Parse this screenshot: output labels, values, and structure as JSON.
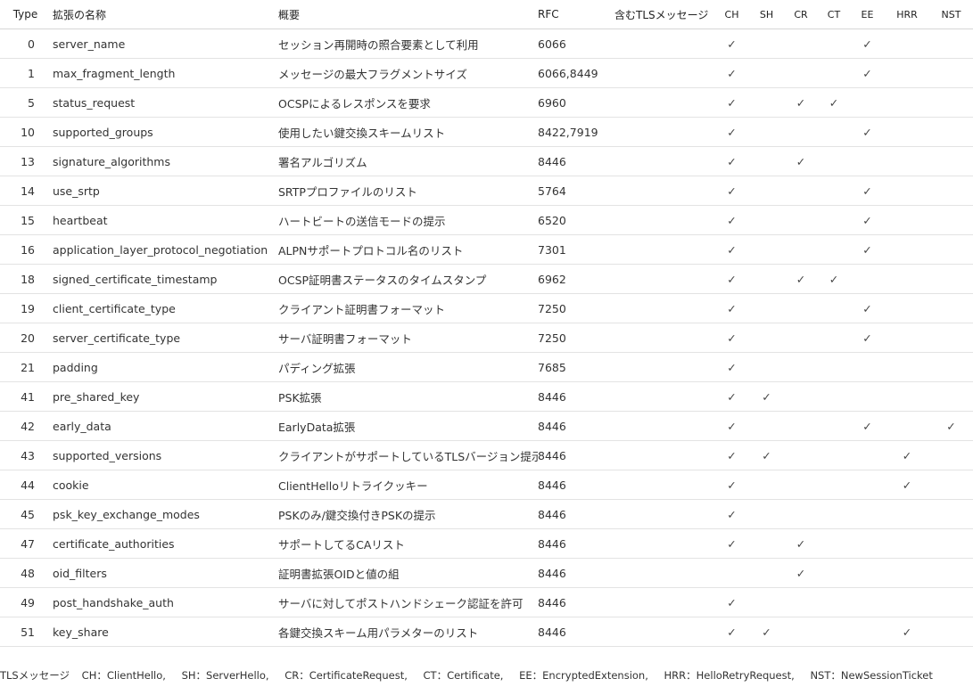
{
  "headers": {
    "type": "Type",
    "name": "拡張の名称",
    "desc": "概要",
    "rfc": "RFC",
    "msg": "含むTLSメッセージ",
    "ch": "CH",
    "sh": "SH",
    "cr": "CR",
    "ct": "CT",
    "ee": "EE",
    "hrr": "HRR",
    "nst": "NST"
  },
  "check_mark": "✓",
  "rows": [
    {
      "type": "0",
      "name": "server_name",
      "desc": "セッション再開時の照合要素として利用",
      "rfc": "6066",
      "ch": "✓",
      "sh": "",
      "cr": "",
      "ct": "",
      "ee": "✓",
      "hrr": "",
      "nst": ""
    },
    {
      "type": "1",
      "name": "max_fragment_length",
      "desc": "メッセージの最大フラグメントサイズ",
      "rfc": "6066,8449",
      "ch": "✓",
      "sh": "",
      "cr": "",
      "ct": "",
      "ee": "✓",
      "hrr": "",
      "nst": ""
    },
    {
      "type": "5",
      "name": "status_request",
      "desc": "OCSPによるレスポンスを要求",
      "rfc": "6960",
      "ch": "✓",
      "sh": "",
      "cr": "✓",
      "ct": "✓",
      "ee": "",
      "hrr": "",
      "nst": ""
    },
    {
      "type": "10",
      "name": "supported_groups",
      "desc": "使用したい鍵交換スキームリスト",
      "rfc": "8422,7919",
      "ch": "✓",
      "sh": "",
      "cr": "",
      "ct": "",
      "ee": "✓",
      "hrr": "",
      "nst": ""
    },
    {
      "type": "13",
      "name": "signature_algorithms",
      "desc": "署名アルゴリズム",
      "rfc": "8446",
      "ch": "✓",
      "sh": "",
      "cr": "✓",
      "ct": "",
      "ee": "",
      "hrr": "",
      "nst": ""
    },
    {
      "type": "14",
      "name": "use_srtp",
      "desc": "SRTPプロファイルのリスト",
      "rfc": "5764",
      "ch": "✓",
      "sh": "",
      "cr": "",
      "ct": "",
      "ee": "✓",
      "hrr": "",
      "nst": ""
    },
    {
      "type": "15",
      "name": "heartbeat",
      "desc": "ハートビートの送信モードの提示",
      "rfc": "6520",
      "ch": "✓",
      "sh": "",
      "cr": "",
      "ct": "",
      "ee": "✓",
      "hrr": "",
      "nst": ""
    },
    {
      "type": "16",
      "name": "application_layer_protocol_negotiation",
      "desc": "ALPNサポートプロトコル名のリスト",
      "rfc": "7301",
      "ch": "✓",
      "sh": "",
      "cr": "",
      "ct": "",
      "ee": "✓",
      "hrr": "",
      "nst": ""
    },
    {
      "type": "18",
      "name": "signed_certificate_timestamp",
      "desc": "OCSP証明書ステータスのタイムスタンプ",
      "rfc": "6962",
      "ch": "✓",
      "sh": "",
      "cr": "✓",
      "ct": "✓",
      "ee": "",
      "hrr": "",
      "nst": ""
    },
    {
      "type": "19",
      "name": "client_certificate_type",
      "desc": "クライアント証明書フォーマット",
      "rfc": "7250",
      "ch": "✓",
      "sh": "",
      "cr": "",
      "ct": "",
      "ee": "✓",
      "hrr": "",
      "nst": ""
    },
    {
      "type": "20",
      "name": "server_certificate_type",
      "desc": "サーバ証明書フォーマット",
      "rfc": "7250",
      "ch": "✓",
      "sh": "",
      "cr": "",
      "ct": "",
      "ee": "✓",
      "hrr": "",
      "nst": ""
    },
    {
      "type": "21",
      "name": "padding",
      "desc": "パディング拡張",
      "rfc": "7685",
      "ch": "✓",
      "sh": "",
      "cr": "",
      "ct": "",
      "ee": "",
      "hrr": "",
      "nst": ""
    },
    {
      "type": "41",
      "name": "pre_shared_key",
      "desc": "PSK拡張",
      "rfc": "8446",
      "ch": "✓",
      "sh": "✓",
      "cr": "",
      "ct": "",
      "ee": "",
      "hrr": "",
      "nst": ""
    },
    {
      "type": "42",
      "name": "early_data",
      "desc": "EarlyData拡張",
      "rfc": "8446",
      "ch": "✓",
      "sh": "",
      "cr": "",
      "ct": "",
      "ee": "✓",
      "hrr": "",
      "nst": "✓"
    },
    {
      "type": "43",
      "name": "supported_versions",
      "desc": "クライアントがサポートしているTLSバージョン提示",
      "rfc": "8446",
      "ch": "✓",
      "sh": "✓",
      "cr": "",
      "ct": "",
      "ee": "",
      "hrr": "✓",
      "nst": ""
    },
    {
      "type": "44",
      "name": "cookie",
      "desc": "ClientHelloリトライクッキー",
      "rfc": "8446",
      "ch": "✓",
      "sh": "",
      "cr": "",
      "ct": "",
      "ee": "",
      "hrr": "✓",
      "nst": ""
    },
    {
      "type": "45",
      "name": "psk_key_exchange_modes",
      "desc": "PSKのみ/鍵交換付きPSKの提示",
      "rfc": "8446",
      "ch": "✓",
      "sh": "",
      "cr": "",
      "ct": "",
      "ee": "",
      "hrr": "",
      "nst": ""
    },
    {
      "type": "47",
      "name": "certificate_authorities",
      "desc": "サポートしてるCAリスト",
      "rfc": "8446",
      "ch": "✓",
      "sh": "",
      "cr": "✓",
      "ct": "",
      "ee": "",
      "hrr": "",
      "nst": ""
    },
    {
      "type": "48",
      "name": "oid_filters",
      "desc": "証明書拡張OIDと値の組",
      "rfc": "8446",
      "ch": "",
      "sh": "",
      "cr": "✓",
      "ct": "",
      "ee": "",
      "hrr": "",
      "nst": ""
    },
    {
      "type": "49",
      "name": "post_handshake_auth",
      "desc": "サーバに対してポストハンドシェーク認証を許可",
      "rfc": "8446",
      "ch": "✓",
      "sh": "",
      "cr": "",
      "ct": "",
      "ee": "",
      "hrr": "",
      "nst": ""
    },
    {
      "type": "51",
      "name": "key_share",
      "desc": "各鍵交換スキーム用パラメターのリスト",
      "rfc": "8446",
      "ch": "✓",
      "sh": "✓",
      "cr": "",
      "ct": "",
      "ee": "",
      "hrr": "✓",
      "nst": ""
    }
  ],
  "footer": {
    "lead": "TLSメッセージ",
    "items": [
      "CH：ClientHello,",
      "SH：ServerHello,",
      "CR：CertificateRequest,",
      "CT：Certificate,",
      "EE：EncryptedExtension,",
      "HRR：HelloRetryRequest,",
      "NST：NewSessionTicket"
    ]
  }
}
